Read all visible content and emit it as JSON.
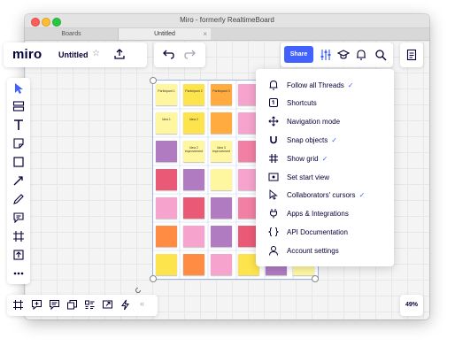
{
  "window": {
    "title": "Miro - formerly RealtimeBoard"
  },
  "tabs": [
    {
      "label": "Boards"
    },
    {
      "label": "Untitled",
      "close": "×"
    }
  ],
  "header": {
    "logo": "miro",
    "board_name": "Untitled",
    "star": "☆",
    "share_label": "Share"
  },
  "zoom": {
    "level": "49%"
  },
  "bottom_toolbar": {
    "collapse": "«"
  },
  "stickies": {
    "participants": [
      "Participant 1",
      "Participant 2",
      "Participant 3"
    ],
    "ideas": [
      "Idea 1",
      "Idea 2",
      "Idea 2 improvement",
      "Idea 3 improvement"
    ]
  },
  "menu": {
    "items": [
      {
        "label": "Follow all Threads",
        "icon": "bell-icon",
        "checked": true
      },
      {
        "label": "Shortcuts",
        "icon": "shortcuts-icon",
        "checked": false
      },
      {
        "label": "Navigation mode",
        "icon": "move-icon",
        "checked": false
      },
      {
        "label": "Snap objects",
        "icon": "magnet-icon",
        "checked": true
      },
      {
        "label": "Show grid",
        "icon": "grid-icon",
        "checked": true
      },
      {
        "label": "Set start view",
        "icon": "eye-icon",
        "checked": false
      },
      {
        "label": "Collaborators' cursors",
        "icon": "cursor-icon",
        "checked": true
      },
      {
        "label": "Apps & Integrations",
        "icon": "plug-icon",
        "checked": false
      },
      {
        "label": "API Documentation",
        "icon": "code-braces-icon",
        "checked": false
      },
      {
        "label": "Account settings",
        "icon": "user-icon",
        "checked": false
      }
    ],
    "check_glyph": "✓"
  },
  "colors": {
    "accent": "#4262ff",
    "ink": "#050038"
  }
}
